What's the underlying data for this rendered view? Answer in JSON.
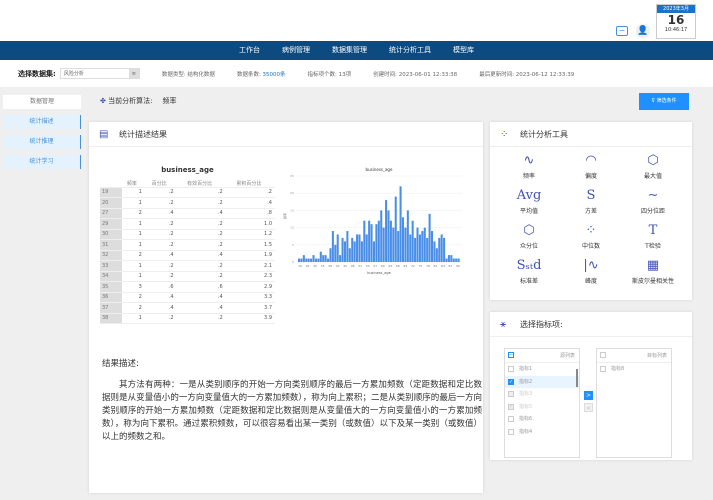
{
  "header": {
    "calendar": {
      "month": "2023年3月",
      "day": "16",
      "time": "10:46:17"
    }
  },
  "nav": [
    "工作台",
    "病例管理",
    "数据集管理",
    "统计分析工具",
    "模型库"
  ],
  "filter": {
    "label": "选择数据集:",
    "dataset": "风险分析",
    "type_label": "数据类型:",
    "type": "结构化数据",
    "count_label": "数据条数:",
    "count": "35000条",
    "items_label": "指标项个数:",
    "items": "13项",
    "created_label": "创建时间:",
    "created": "2023-06-01 12:33:38",
    "updated_label": "最后更新时间:",
    "updated": "2023-06-12 12:33:39"
  },
  "sidebar": [
    "数据管理",
    "统计描述",
    "统计推理",
    "统计学习"
  ],
  "algo": {
    "label": "当前分析算法:",
    "value": "频率"
  },
  "filter_button": "筛选条件",
  "main": {
    "title": "统计描述结果",
    "desc_label": "结果描述:",
    "desc": "其方法有两种：一是从类别顺序的开始一方向类别顺序的最后一方累加频数（定距数据和定比数据则是从变量值小的一方向变量值大的一方累加频数），称为向上累积；二是从类别顺序的最后一方向类别顺序的开始一方累加频数（定距数据和定比数据则是从变量值大的一方向变量值小的一方累加频数），称为向下累积。通过累积频数，可以很容易看出某一类别（或数值）以下及某一类别（或数值）以上的频数之和。"
  },
  "table": {
    "title": "business_age",
    "columns": [
      "频率",
      "百分比",
      "有效百分比",
      "累积百分比"
    ],
    "rows": [
      [
        "19",
        "1",
        ".2",
        ".2",
        ".2"
      ],
      [
        "20",
        "1",
        ".2",
        ".2",
        ".4"
      ],
      [
        "27",
        "2",
        ".4",
        ".4",
        ".8"
      ],
      [
        "29",
        "1",
        ".2",
        ".2",
        "1.0"
      ],
      [
        "30",
        "1",
        ".2",
        ".2",
        "1.2"
      ],
      [
        "31",
        "1",
        ".2",
        ".2",
        "1.5"
      ],
      [
        "32",
        "2",
        ".4",
        ".4",
        "1.9"
      ],
      [
        "33",
        "1",
        ".2",
        ".2",
        "2.1"
      ],
      [
        "34",
        "1",
        ".2",
        ".2",
        "2.3"
      ],
      [
        "35",
        "3",
        ".6",
        ".6",
        "2.9"
      ],
      [
        "36",
        "2",
        ".4",
        ".4",
        "3.3"
      ],
      [
        "37",
        "2",
        ".4",
        ".4",
        "3.7"
      ],
      [
        "38",
        "1",
        ".2",
        ".2",
        "3.9"
      ]
    ]
  },
  "chart_data": {
    "type": "bar",
    "title": "business_age",
    "xlabel": "business_age",
    "ylabel": "频率",
    "ylim": [
      0,
      25
    ],
    "yticks": [
      0,
      5,
      10,
      15,
      20,
      25
    ],
    "grid": true,
    "color": "#4a8ee8",
    "xticks": [
      "19",
      "26",
      "32",
      "35",
      "38",
      "42",
      "45",
      "48",
      "51",
      "54",
      "57",
      "60",
      "63",
      "66",
      "69",
      "72",
      "75",
      "78",
      "81",
      "84",
      "87",
      "90"
    ],
    "values": [
      1,
      1,
      2,
      1,
      1,
      1,
      2,
      1,
      1,
      3,
      2,
      2,
      1,
      4,
      9,
      5,
      8,
      2,
      7,
      6,
      9,
      4,
      7,
      6,
      8,
      8,
      6,
      12,
      8,
      12,
      11,
      6,
      11,
      12,
      15,
      10,
      18,
      15,
      12,
      10,
      19,
      9,
      22,
      13,
      10,
      15,
      8,
      12,
      7,
      10,
      8,
      9,
      10,
      7,
      14,
      9,
      6,
      4,
      7,
      8,
      7,
      1,
      2,
      2,
      1,
      1,
      1
    ]
  },
  "tools": {
    "title": "统计分析工具",
    "items": [
      {
        "label": "频率",
        "icon": "pulse-icon",
        "g": "∿"
      },
      {
        "label": "偏度",
        "icon": "gauge-icon",
        "g": "◠"
      },
      {
        "label": "最大值",
        "icon": "hexagon-icon",
        "g": "⬡"
      },
      {
        "label": "平均值",
        "icon": "avg-icon",
        "g": "Avg"
      },
      {
        "label": "方差",
        "icon": "variance-icon",
        "g": "S"
      },
      {
        "label": "四分位距",
        "icon": "wave-icon",
        "g": "∼"
      },
      {
        "label": "众分位",
        "icon": "hexagon-chart-icon",
        "g": "⬡"
      },
      {
        "label": "中位数",
        "icon": "scatter-icon",
        "g": "⁘"
      },
      {
        "label": "T检验",
        "icon": "t-test-icon",
        "g": "T"
      },
      {
        "label": "标准差",
        "icon": "std-icon",
        "g": "Sₛₜd"
      },
      {
        "label": "峰度",
        "icon": "kurtosis-icon",
        "g": "|∿"
      },
      {
        "label": "斯皮尔曼相关性",
        "icon": "grid-icon",
        "g": "▦"
      }
    ]
  },
  "picker": {
    "title": "选择指标项:",
    "source_title": "源列表",
    "target_title": "目标列表",
    "source": [
      {
        "label": "指标1",
        "checked": false
      },
      {
        "label": "指标2",
        "checked": true
      },
      {
        "label": "指标3",
        "disabled": true
      },
      {
        "label": "指标5",
        "checked": true,
        "disabled": true
      },
      {
        "label": "指标6"
      },
      {
        "label": "指标4"
      }
    ],
    "target": [
      {
        "label": "指标8"
      }
    ],
    "right": ">",
    "left": "<"
  }
}
